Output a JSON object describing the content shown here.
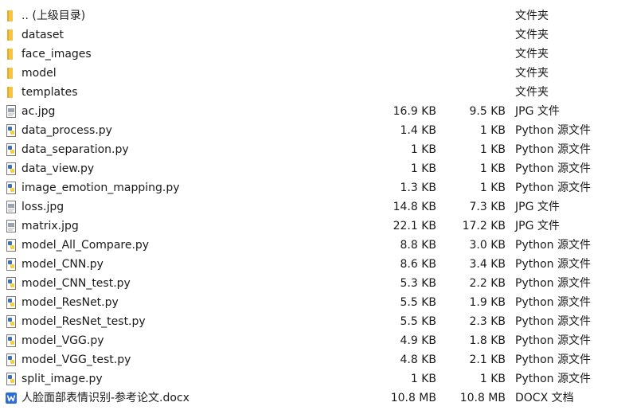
{
  "file_list": {
    "rows": [
      {
        "name": ".. (上级目录)",
        "size": "",
        "compressed": "",
        "type": "文件夹",
        "icon": "folder-icon"
      },
      {
        "name": "dataset",
        "size": "",
        "compressed": "",
        "type": "文件夹",
        "icon": "folder-icon"
      },
      {
        "name": "face_images",
        "size": "",
        "compressed": "",
        "type": "文件夹",
        "icon": "folder-icon"
      },
      {
        "name": "model",
        "size": "",
        "compressed": "",
        "type": "文件夹",
        "icon": "folder-icon"
      },
      {
        "name": "templates",
        "size": "",
        "compressed": "",
        "type": "文件夹",
        "icon": "folder-icon"
      },
      {
        "name": "ac.jpg",
        "size": "16.9 KB",
        "compressed": "9.5 KB",
        "type": "JPG 文件",
        "icon": "image-file-icon"
      },
      {
        "name": "data_process.py",
        "size": "1.4 KB",
        "compressed": "1 KB",
        "type": "Python 源文件",
        "icon": "python-file-icon"
      },
      {
        "name": "data_separation.py",
        "size": "1 KB",
        "compressed": "1 KB",
        "type": "Python 源文件",
        "icon": "python-file-icon"
      },
      {
        "name": "data_view.py",
        "size": "1 KB",
        "compressed": "1 KB",
        "type": "Python 源文件",
        "icon": "python-file-icon"
      },
      {
        "name": "image_emotion_mapping.py",
        "size": "1.3 KB",
        "compressed": "1 KB",
        "type": "Python 源文件",
        "icon": "python-file-icon"
      },
      {
        "name": "loss.jpg",
        "size": "14.8 KB",
        "compressed": "7.3 KB",
        "type": "JPG 文件",
        "icon": "image-file-icon"
      },
      {
        "name": "matrix.jpg",
        "size": "22.1 KB",
        "compressed": "17.2 KB",
        "type": "JPG 文件",
        "icon": "image-file-icon"
      },
      {
        "name": "model_All_Compare.py",
        "size": "8.8 KB",
        "compressed": "3.0 KB",
        "type": "Python 源文件",
        "icon": "python-file-icon"
      },
      {
        "name": "model_CNN.py",
        "size": "8.6 KB",
        "compressed": "3.4 KB",
        "type": "Python 源文件",
        "icon": "python-file-icon"
      },
      {
        "name": "model_CNN_test.py",
        "size": "5.3 KB",
        "compressed": "2.2 KB",
        "type": "Python 源文件",
        "icon": "python-file-icon"
      },
      {
        "name": "model_ResNet.py",
        "size": "5.5 KB",
        "compressed": "1.9 KB",
        "type": "Python 源文件",
        "icon": "python-file-icon"
      },
      {
        "name": "model_ResNet_test.py",
        "size": "5.5 KB",
        "compressed": "2.3 KB",
        "type": "Python 源文件",
        "icon": "python-file-icon"
      },
      {
        "name": "model_VGG.py",
        "size": "4.9 KB",
        "compressed": "1.8 KB",
        "type": "Python 源文件",
        "icon": "python-file-icon"
      },
      {
        "name": "model_VGG_test.py",
        "size": "4.8 KB",
        "compressed": "2.1 KB",
        "type": "Python 源文件",
        "icon": "python-file-icon"
      },
      {
        "name": "split_image.py",
        "size": "1 KB",
        "compressed": "1 KB",
        "type": "Python 源文件",
        "icon": "python-file-icon"
      },
      {
        "name": "人脸面部表情识别-参考论文.docx",
        "size": "10.8 MB",
        "compressed": "10.8 MB",
        "type": "DOCX 文档",
        "icon": "word-document-icon"
      }
    ]
  },
  "colors": {
    "text": "#1a1a1a",
    "folder": "#f6c445",
    "python_blue": "#3b74b5",
    "python_yellow": "#f5cf3c",
    "word_blue": "#2b6dd6"
  }
}
